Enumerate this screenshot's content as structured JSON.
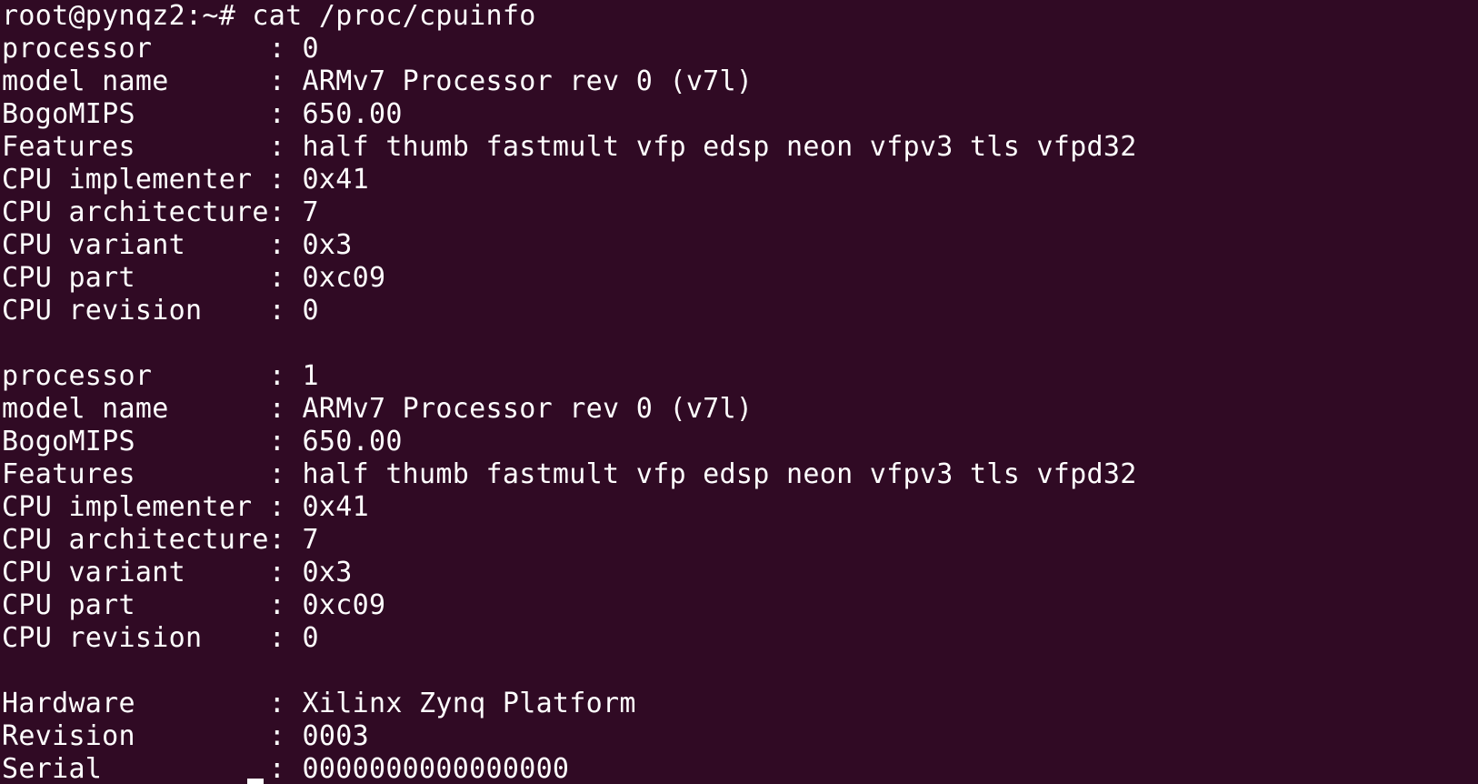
{
  "terminal": {
    "prompt": "root@pynqz2:~# cat /proc/cpuinfo",
    "lines": [
      "processor       : 0",
      "model name      : ARMv7 Processor rev 0 (v7l)",
      "BogoMIPS        : 650.00",
      "Features        : half thumb fastmult vfp edsp neon vfpv3 tls vfpd32",
      "CPU implementer : 0x41",
      "CPU architecture: 7",
      "CPU variant     : 0x3",
      "CPU part        : 0xc09",
      "CPU revision    : 0",
      "",
      "processor       : 1",
      "model name      : ARMv7 Processor rev 0 (v7l)",
      "BogoMIPS        : 650.00",
      "Features        : half thumb fastmult vfp edsp neon vfpv3 tls vfpd32",
      "CPU implementer : 0x41",
      "CPU architecture: 7",
      "CPU variant     : 0x3",
      "CPU part        : 0xc09",
      "CPU revision    : 0",
      "",
      "Hardware        : Xilinx Zynq Platform",
      "Revision        : 0003",
      "Serial          : 0000000000000000"
    ]
  },
  "colors": {
    "background": "#300a24",
    "foreground": "#ffffff"
  }
}
